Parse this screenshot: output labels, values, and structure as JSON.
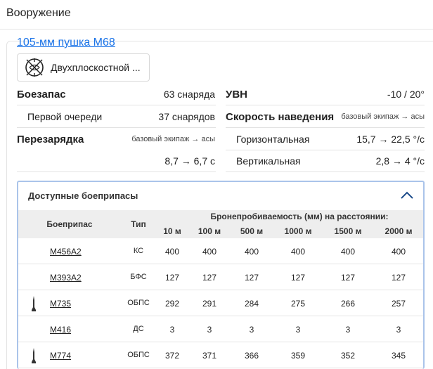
{
  "header": {
    "title": "Вооружение"
  },
  "weapon": {
    "name": "105-мм пушка М68",
    "modification_button": {
      "label": "Двухплоскостной ...",
      "icon": "stabilizer-icon"
    }
  },
  "stats_left": {
    "ammo_label": "Боезапас",
    "ammo_value": "63 снаряда",
    "first_stage_label": "Первой очереди",
    "first_stage_value": "37 снарядов",
    "reload_label": "Перезарядка",
    "reload_note": "базовый экипаж → асы",
    "reload_value": "8,7 → 6,7 с"
  },
  "stats_right": {
    "vertical_guidance_label": "УВН",
    "vertical_guidance_value": "-10 / 20°",
    "traverse_speed_label": "Скорость наведения",
    "traverse_note": "базовый экипаж → асы",
    "horizontal_label": "Горизонтальная",
    "horizontal_value": "15,7 → 22,5 °/с",
    "vertical_label": "Вертикальная",
    "vertical_value": "2,8 → 4 °/с"
  },
  "ammo_table": {
    "title": "Доступные боеприпасы",
    "col_name": "Боеприпас",
    "col_type": "Тип",
    "penetration_header": "Бронепробиваемость (мм) на расстоянии:",
    "distances": [
      "10 м",
      "100 м",
      "500 м",
      "1000 м",
      "1500 м",
      "2000 м"
    ],
    "rows": [
      {
        "name": "M456A2",
        "type": "КС",
        "icon": "",
        "values": [
          "400",
          "400",
          "400",
          "400",
          "400",
          "400"
        ]
      },
      {
        "name": "M393A2",
        "type": "БФС",
        "icon": "",
        "values": [
          "127",
          "127",
          "127",
          "127",
          "127",
          "127"
        ]
      },
      {
        "name": "M735",
        "type": "ОБПС",
        "icon": "apfsds-shell-icon",
        "values": [
          "292",
          "291",
          "284",
          "275",
          "266",
          "257"
        ]
      },
      {
        "name": "M416",
        "type": "ДС",
        "icon": "",
        "values": [
          "3",
          "3",
          "3",
          "3",
          "3",
          "3"
        ]
      },
      {
        "name": "M774",
        "type": "ОБПС",
        "icon": "apfsds-shell-icon",
        "values": [
          "372",
          "371",
          "366",
          "359",
          "352",
          "345"
        ]
      }
    ]
  }
}
